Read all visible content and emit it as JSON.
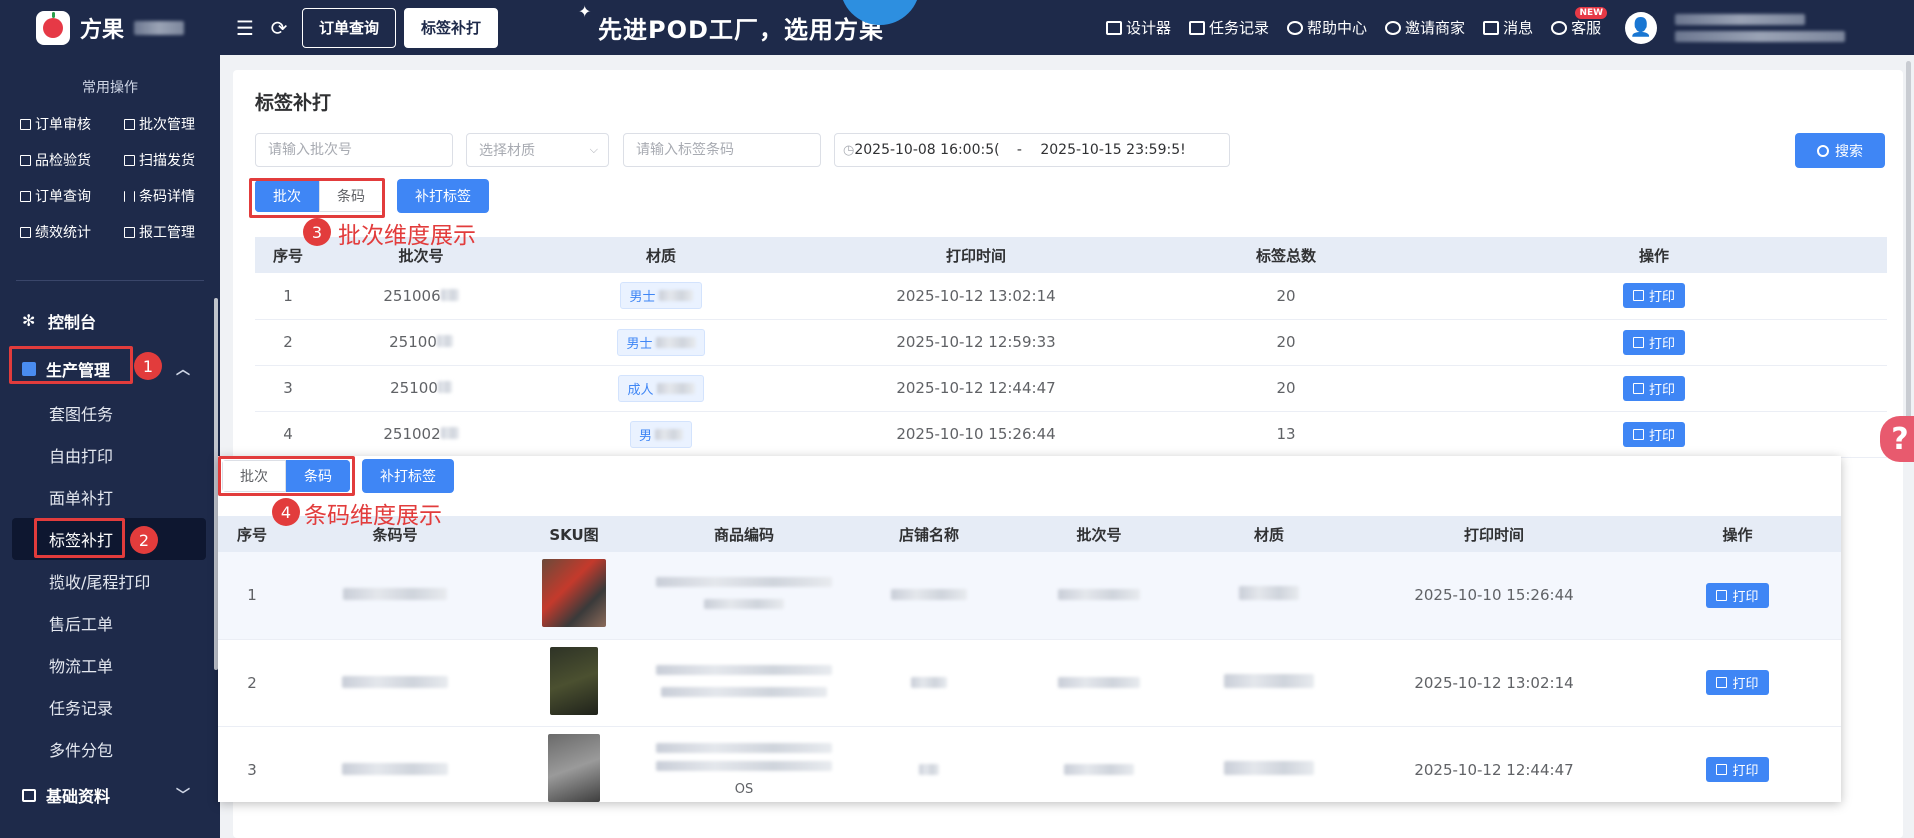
{
  "header": {
    "logo_text": "方果",
    "order_query_btn": "订单查询",
    "label_reprint_tab": "标签补打",
    "slogan": "先进POD工厂，选用方果",
    "links": [
      {
        "label": "设计器",
        "icon": "image-icon"
      },
      {
        "label": "任务记录",
        "icon": "list-icon"
      },
      {
        "label": "帮助中心",
        "icon": "help-icon"
      },
      {
        "label": "邀请商家",
        "icon": "user-add-icon"
      },
      {
        "label": "消息",
        "icon": "message-icon"
      },
      {
        "label": "客服",
        "icon": "headset-icon",
        "badge": "NEW"
      }
    ]
  },
  "sidebar": {
    "common_title": "常用操作",
    "quick": [
      "订单审核",
      "批次管理",
      "品检验货",
      "扫描发货",
      "订单查询",
      "条码详情",
      "绩效统计",
      "报工管理"
    ],
    "dashboard": "控制台",
    "production": "生产管理",
    "sub_items": [
      "套图任务",
      "自由打印",
      "面单补打",
      "标签补打",
      "揽收/尾程打印",
      "售后工单",
      "物流工单",
      "任务记录",
      "多件分包"
    ],
    "base_data": "基础资料"
  },
  "main": {
    "title": "标签补打",
    "filters": {
      "batch_placeholder": "请输入批次号",
      "material_placeholder": "选择材质",
      "barcode_placeholder": "请输入标签条码",
      "date_start": "2025-10-08 16:00:5(",
      "date_sep": "-",
      "date_end": "2025-10-15 23:59:5!"
    },
    "search": "搜索",
    "seg_batch": "批次",
    "seg_barcode": "条码",
    "reprint_btn": "补打标签",
    "table1": {
      "headers": [
        "序号",
        "批次号",
        "材质",
        "打印时间",
        "标签总数",
        "操作"
      ],
      "rows": [
        {
          "no": "1",
          "batch": "251006",
          "material": "男士",
          "time": "2025-10-12 13:02:14",
          "count": "20"
        },
        {
          "no": "2",
          "batch": "25100",
          "material": "男士",
          "time": "2025-10-12 12:59:33",
          "count": "20"
        },
        {
          "no": "3",
          "batch": "25100",
          "material": "成人",
          "time": "2025-10-12 12:44:47",
          "count": "20"
        },
        {
          "no": "4",
          "batch": "251002",
          "material": "男",
          "time": "2025-10-10 15:26:44",
          "count": "13"
        }
      ]
    },
    "print_label": "打印"
  },
  "overlay": {
    "headers": [
      "序号",
      "条码号",
      "SKU图",
      "商品编码",
      "店铺名称",
      "批次号",
      "材质",
      "打印时间",
      "操作"
    ],
    "rows": [
      {
        "no": "1",
        "time": "2025-10-10 15:26:44"
      },
      {
        "no": "2",
        "time": "2025-10-12 13:02:14"
      },
      {
        "no": "3",
        "time": "2025-10-12 12:44:47"
      }
    ],
    "partial_text": "OS"
  },
  "annotations": {
    "b1": "1",
    "b2": "2",
    "b3": "3",
    "b4": "4",
    "note3": "批次维度展示",
    "note4": "条码维度展示"
  },
  "colors": {
    "accent": "#3f86f5",
    "sidebar": "#1e2a4a",
    "annotation": "#e23c3c"
  }
}
